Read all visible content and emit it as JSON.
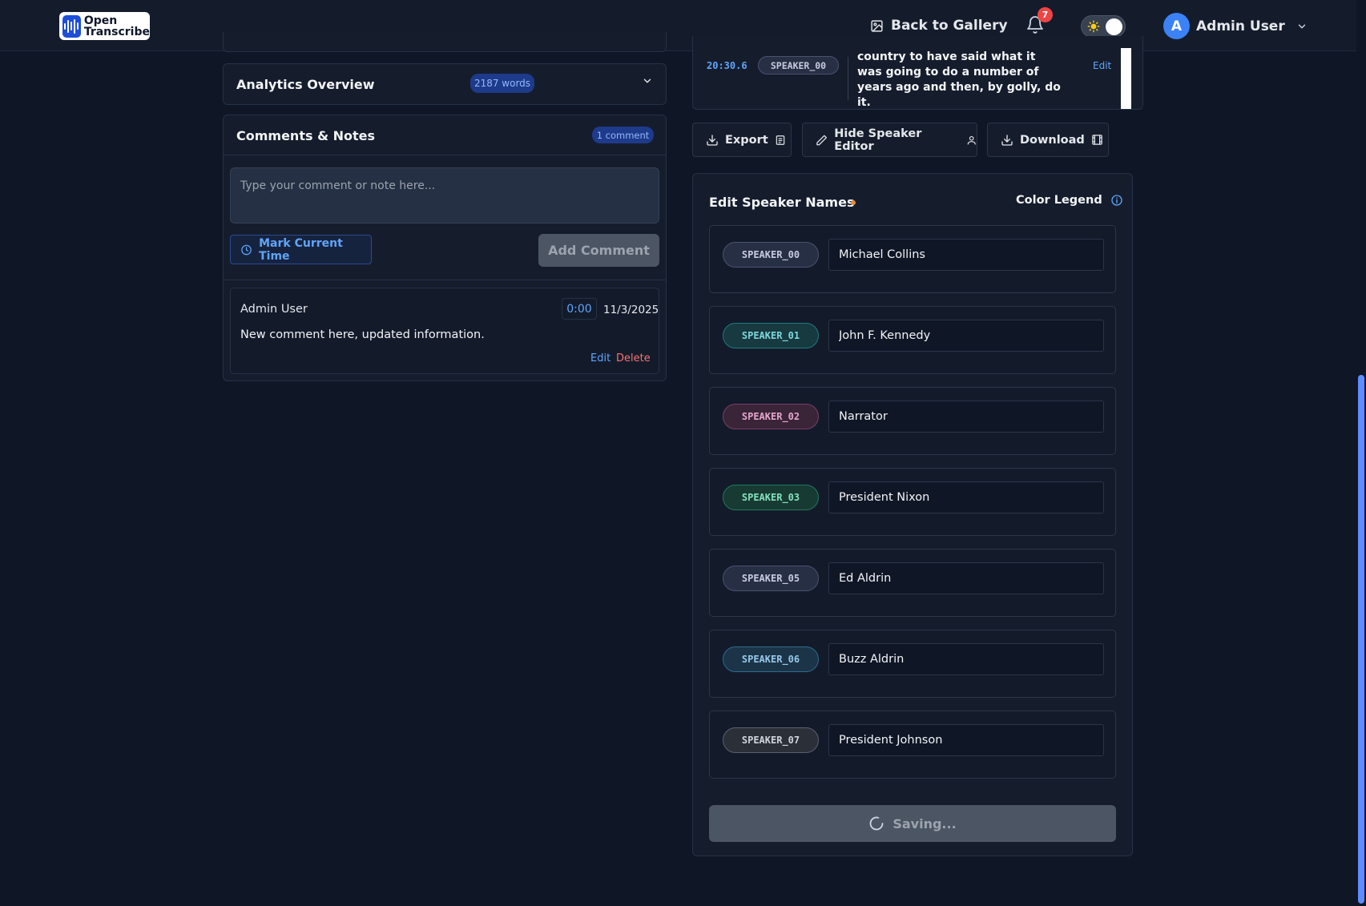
{
  "app": {
    "logo_line1": "Open",
    "logo_line2": "Transcribe"
  },
  "nav": {
    "back_label": "Back to Gallery",
    "notification_count": "7",
    "user_initial": "A",
    "user_name": "Admin User"
  },
  "analytics": {
    "title": "Analytics Overview",
    "badge": "2187 words"
  },
  "comments": {
    "title": "Comments & Notes",
    "badge": "1 comment",
    "placeholder": "Type your comment or note here...",
    "mark_time_label": "Mark Current Time",
    "add_label": "Add Comment",
    "items": [
      {
        "author": "Admin User",
        "time": "0:00",
        "date": "11/3/2025",
        "text": "New comment here, updated information.",
        "edit_label": "Edit",
        "delete_label": "Delete"
      }
    ]
  },
  "transcript": {
    "segment": {
      "time": "20:30.6",
      "speaker": "SPEAKER_00",
      "text": "country to have said what it was going to do a number of years ago and then, by golly, do it.",
      "edit_label": "Edit"
    }
  },
  "actions": {
    "export_label": "Export",
    "hide_editor_label": "Hide Speaker Editor",
    "download_label": "Download"
  },
  "speaker_editor": {
    "title": "Edit Speaker Names",
    "legend_label": "Color Legend",
    "save_label": "Saving...",
    "speakers": [
      {
        "id": "SPEAKER_00",
        "name": "Michael Collins",
        "bg": "#272f45",
        "border": "#4b5270",
        "fg": "#c7cbe0"
      },
      {
        "id": "SPEAKER_01",
        "name": "John F. Kennedy",
        "bg": "#163a3f",
        "border": "#1f7a80",
        "fg": "#7fd6dd"
      },
      {
        "id": "SPEAKER_02",
        "name": "Narrator",
        "bg": "#3a2438",
        "border": "#7a3f6a",
        "fg": "#e4a7cf"
      },
      {
        "id": "SPEAKER_03",
        "name": "President Nixon",
        "bg": "#173a32",
        "border": "#1f7a5e",
        "fg": "#86e0bd"
      },
      {
        "id": "SPEAKER_05",
        "name": "Ed Aldrin",
        "bg": "#272f45",
        "border": "#4b5270",
        "fg": "#c7cbe0"
      },
      {
        "id": "SPEAKER_06",
        "name": "Buzz Aldrin",
        "bg": "#1b3447",
        "border": "#2f6a8f",
        "fg": "#98c9ea"
      },
      {
        "id": "SPEAKER_07",
        "name": "President Johnson",
        "bg": "#2a2f38",
        "border": "#5a616d",
        "fg": "#d1d5db"
      }
    ]
  }
}
